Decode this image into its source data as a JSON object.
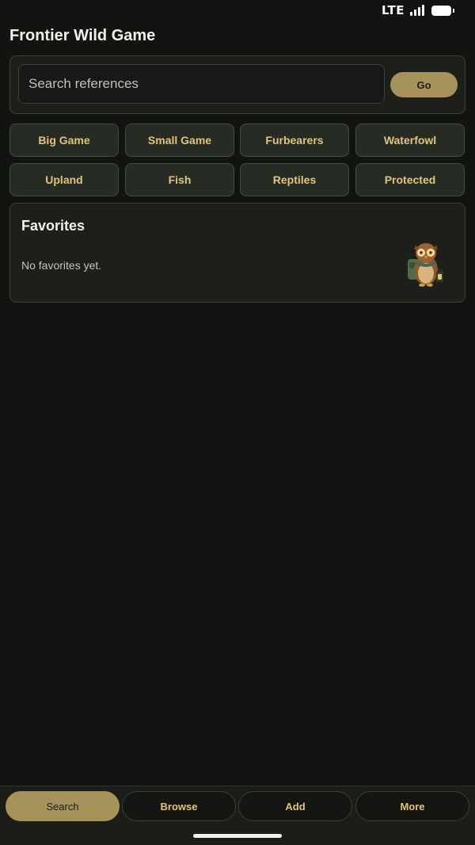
{
  "status_bar": {
    "network": "LTE"
  },
  "app": {
    "title": "Frontier Wild Game"
  },
  "search": {
    "placeholder": "Search references",
    "value": "",
    "go_label": "Go"
  },
  "categories": [
    "Big Game",
    "Small Game",
    "Furbearers",
    "Waterfowl",
    "Upland",
    "Fish",
    "Reptiles",
    "Protected"
  ],
  "favorites": {
    "title": "Favorites",
    "empty_text": "No favorites yet.",
    "illustration_icon": "owl-explorer-icon"
  },
  "nav": {
    "items": [
      "Search",
      "Browse",
      "Add",
      "More"
    ],
    "active": "Search"
  },
  "colors": {
    "background": "#121411",
    "panel": "#1c1f1a",
    "accent": "#a6925a",
    "chip_text": "#e4c378"
  }
}
